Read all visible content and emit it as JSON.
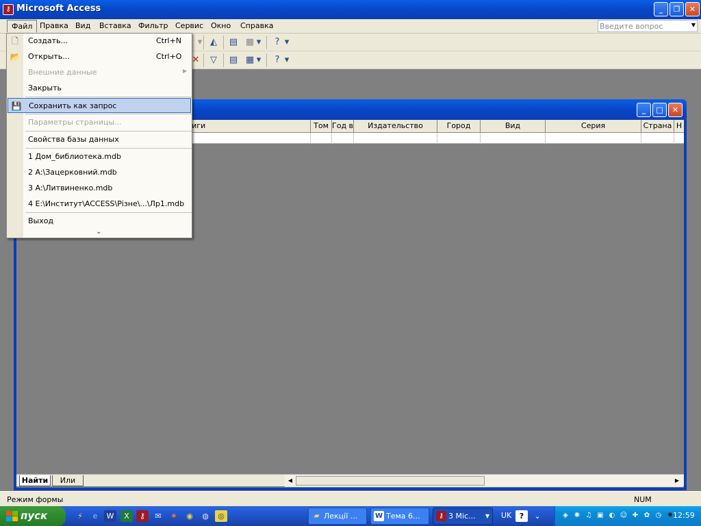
{
  "window": {
    "title": "Microsoft Access",
    "icon": "access-key-icon"
  },
  "menubar": {
    "items": [
      "Файл",
      "Правка",
      "Вид",
      "Вставка",
      "Фильтр",
      "Сервис",
      "Окно",
      "Справка"
    ],
    "ask_placeholder": "Введите вопрос"
  },
  "file_menu": {
    "items": [
      {
        "label": "Создать...",
        "shortcut": "Ctrl+N",
        "icon": "new-document-icon",
        "disabled": false
      },
      {
        "label": "Открыть...",
        "shortcut": "Ctrl+O",
        "icon": "open-folder-icon",
        "disabled": false
      },
      {
        "label": "Внешние данные",
        "shortcut": "",
        "disabled": true,
        "submenu": true
      },
      {
        "label": "Закрыть",
        "shortcut": "",
        "disabled": false
      },
      {
        "label": "Сохранить как запрос",
        "shortcut": "",
        "icon": "save-icon",
        "disabled": false,
        "selected": true
      },
      {
        "label": "Параметры страницы...",
        "shortcut": "",
        "disabled": true
      },
      {
        "label": "Свойства базы данных",
        "shortcut": "",
        "disabled": false
      },
      {
        "label": "1 Дом_библиотека.mdb",
        "shortcut": "",
        "disabled": false
      },
      {
        "label": "2 A:\\Зацерковний.mdb",
        "shortcut": "",
        "disabled": false
      },
      {
        "label": "3 A:\\Литвиненко.mdb",
        "shortcut": "",
        "disabled": false
      },
      {
        "label": "4 E:\\Институт\\ACCESS\\Різне\\...\\Лр1.mdb",
        "shortcut": "",
        "disabled": false
      },
      {
        "label": "Выход",
        "shortcut": "",
        "disabled": false
      }
    ],
    "more_glyph": "⌄"
  },
  "grid": {
    "columns": [
      "произведения, книги",
      "Том",
      "Год в",
      "Издательство",
      "Город",
      "Вид",
      "Серия",
      "Страна",
      "Н"
    ]
  },
  "filter_tabs": [
    "Найти",
    "Или"
  ],
  "status": {
    "text": "Режим формы",
    "num": "NUM"
  },
  "taskbar": {
    "start_label": "пуск",
    "tasks": [
      {
        "label": "Лекції ...",
        "icon": "folder-icon"
      },
      {
        "label": "Тема 6...",
        "icon": "word-icon"
      },
      {
        "label": "3 Mic...",
        "icon": "access-icon",
        "active": true
      }
    ],
    "language": "UK",
    "clock": "12:59"
  }
}
